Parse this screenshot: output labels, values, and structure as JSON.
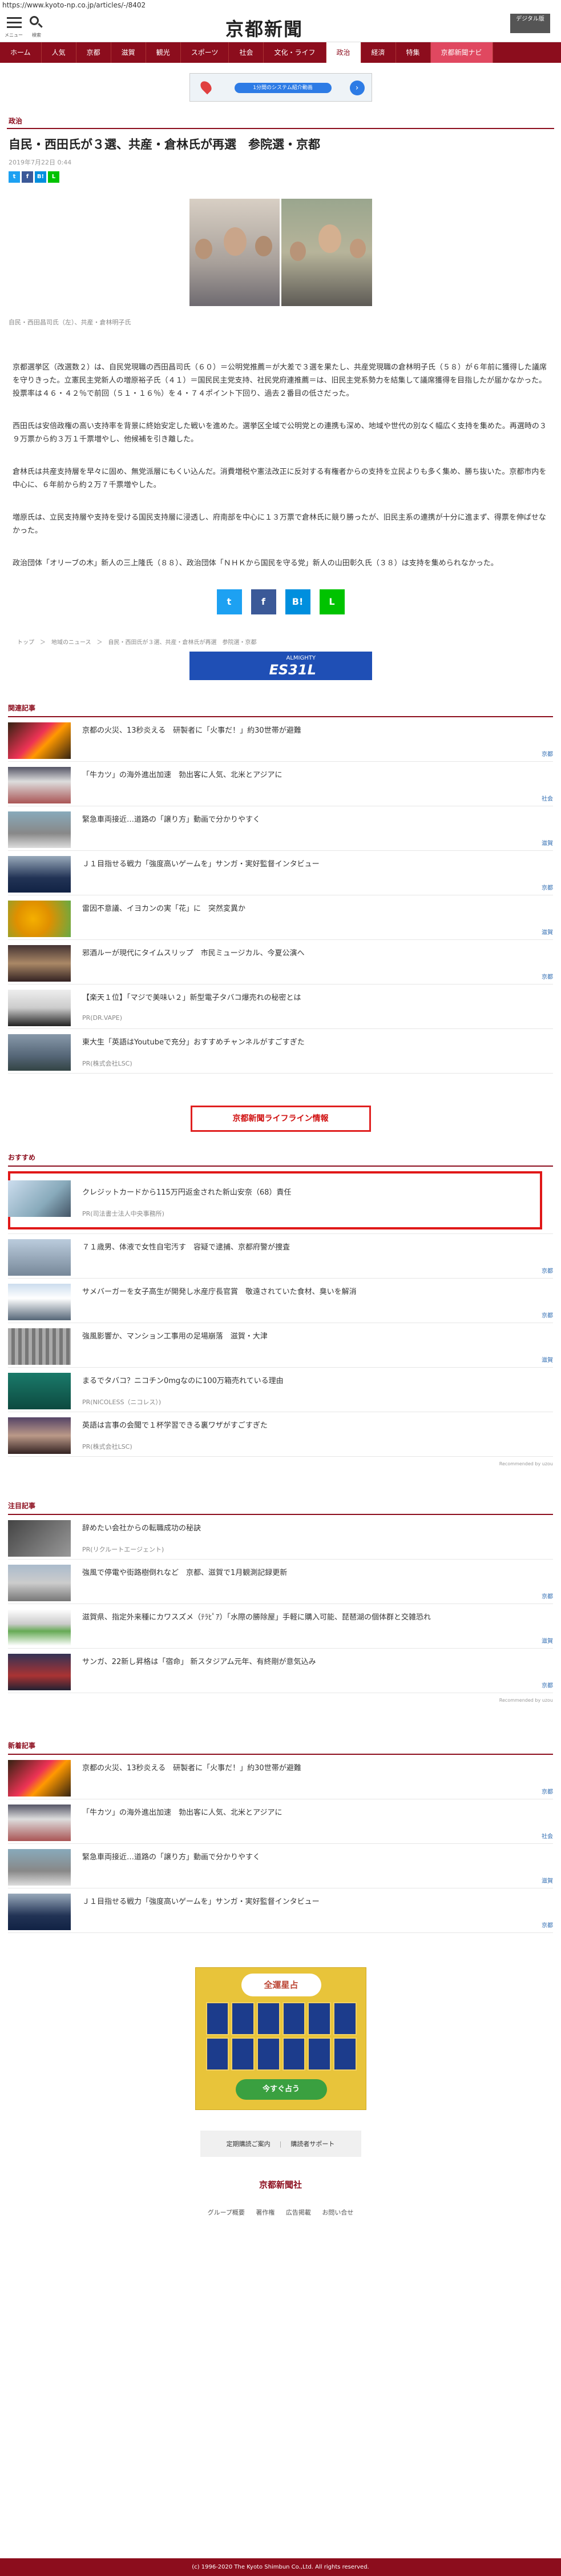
{
  "url": "https://www.kyoto-np.co.jp/articles/-/8402",
  "header": {
    "menu_label": "メニュー",
    "search_label": "検索",
    "logo": "京都新聞",
    "digital_label": "デジタル版"
  },
  "nav": [
    "ホーム",
    "人気",
    "京都",
    "滋賀",
    "観光",
    "スポーツ",
    "社会",
    "文化・ライフ",
    "政治",
    "経済",
    "特集",
    "京都新聞ナビ"
  ],
  "ad_top": {
    "pill": "1分間のシステム紹介動画"
  },
  "article": {
    "category": "政治",
    "title": "自民・西田氏が３選、共産・倉林氏が再選　参院選・京都",
    "date": "2019年7月22日 0:44",
    "caption": "自民・西田昌司氏（左）、共産・倉林明子氏",
    "paragraphs": [
      "京都選挙区（改選数２）は、自民党現職の西田昌司氏（６０）＝公明党推薦＝が大差で３選を果たし、共産党現職の倉林明子氏（５８）が６年前に獲得した議席を守りきった。立憲民主党新人の増原裕子氏（４１）＝国民民主党支持、社民党府連推薦＝は、旧民主党系勢力を結集して議席獲得を目指したが届かなかった。投票率は４６・４２％で前回（５１・１６％）を４・７４ポイント下回り、過去２番目の低さだった。",
      "西田氏は安倍政権の高い支持率を背景に終始安定した戦いを進めた。選挙区全域で公明党との連携も深め、地域や世代の別なく幅広く支持を集めた。再選時の３９万票から約３万１千票増やし、他候補を引き離した。",
      "倉林氏は共産支持層を早々に固め、無党派層にもくい込んだ。消費増税や憲法改正に反対する有権者からの支持を立民よりも多く集め、勝ち抜いた。京都市内を中心に、６年前から約２万７千票増やした。",
      "増原氏は、立民支持層や支持を受ける国民支持層に浸透し、府南部を中心に１３万票で倉林氏に競り勝ったが、旧民主系の連携が十分に進まず、得票を伸ばせなかった。",
      "政治団体「オリーブの木」新人の三上隆氏（８８）、政治団体「ＮＨＫから国民を守る党」新人の山田彰久氏（３８）は支持を集められなかった。"
    ],
    "breadcrumb": "トップ　＞　地域のニュース　＞　自民・西田氏が３選、共産・倉林氏が再選　参院選・京都"
  },
  "ad_banner": {
    "top": "ALMIGHTY",
    "big": "ES31L"
  },
  "related": {
    "heading": "関連記事",
    "items": [
      {
        "title": "京都の火災、13秒炎える　研製者に「火事だ！」約30世帯が避難",
        "tag": "京都"
      },
      {
        "title": "「牛カツ」の海外進出加速　勃出客に人気、北米とアジアに",
        "tag": "社会"
      },
      {
        "title": "緊急車両接近…道路の「譲り方」動画で分かりやすく",
        "tag": "滋賀"
      },
      {
        "title": "Ｊ１目指せる戦力「強度高いゲームを」サンガ・実好監督インタビュー",
        "tag": "京都"
      },
      {
        "title": "雷因不意議、イヨカンの実「花」に　突然変異か",
        "tag": "滋賀"
      },
      {
        "title": "邪酒ルーが現代にタイムスリップ　市民ミュージカル、今夏公演へ",
        "tag": "京都"
      },
      {
        "title": "【楽天１位】「マジで美味い２」新型電子タバコ爆売れの秘密とは",
        "pr": "PR(DR.VAPE)"
      },
      {
        "title": "東大生「英語はYoutubeで充分」おすすめチャンネルがすごすぎた",
        "pr": "PR(株式会社LSC)"
      }
    ]
  },
  "lifeline": "京都新聞ライフライン情報",
  "recommend": {
    "heading": "おすすめ",
    "items": [
      {
        "title": "クレジットカードから115万円返金された新山安奈（68）責任",
        "pr": "PR(司法書士法人中央事務所)"
      },
      {
        "title": "７１歳男、体液で女性自宅汚す　容疑で逮捕、京都府警が捜査",
        "tag": "京都"
      },
      {
        "title": "サメバーガーを女子高生が開発し水産庁長官賞　敬遠されていた食材、臭いを解消",
        "tag": "京都"
      },
      {
        "title": "強風影響か、マンション工事用の足場崩落　滋賀・大津",
        "tag": "滋賀"
      },
      {
        "title": "まるでタバコ？ニコチン0mgなのに100万箱売れている理由",
        "pr": "PR(NICOLESS（ニコレス）)"
      },
      {
        "title": "英語は言事の会聞で１杯学習できる裏ワザがすごすぎた",
        "pr": "PR(株式会社LSC)"
      }
    ],
    "by": "Recommended by uzou"
  },
  "attention": {
    "heading": "注目記事",
    "items": [
      {
        "title": "辞めたい会社からの転職成功の秘訣",
        "pr": "PR(リクルートエージェント)"
      },
      {
        "title": "強風で停電や街路樹倒れなど　京都、滋賀で1月観測記録更新",
        "tag": "京都"
      },
      {
        "title": "滋賀県、指定外来種にカワスズメ（ﾃﾗﾋﾟｱ）「水際の勝除屋」手軽に購入可能、琵琶湖の個体群と交雑恐れ",
        "tag": "滋賀"
      },
      {
        "title": "サンガ、22新し昇格は「宿命」 新スタジアム元年、有終剛が意気込み",
        "tag": "京都"
      }
    ],
    "by": "Recommended by uzou"
  },
  "newest": {
    "heading": "新着記事",
    "items": [
      {
        "title": "京都の火災、13秒炎える　研製者に「火事だ！」約30世帯が避難",
        "tag": "京都"
      },
      {
        "title": "「牛カツ」の海外進出加速　勃出客に人気、北米とアジアに",
        "tag": "社会"
      },
      {
        "title": "緊急車両接近…道路の「譲り方」動画で分かりやすく",
        "tag": "滋賀"
      },
      {
        "title": "Ｊ１目指せる戦力「強度高いゲームを」サンガ・実好監督インタビュー",
        "tag": "京都"
      }
    ]
  },
  "ad_square": {
    "title": "全運星占",
    "button": "今すぐ占う"
  },
  "foot": {
    "links": [
      "定期購読ご案内",
      "購読者サポート"
    ],
    "logo": "京都新聞社",
    "nav": [
      "グループ概要",
      "著作権",
      "広告掲載",
      "お問い合せ"
    ],
    "copyright": "(c) 1996-2020 The Kyoto Shimbun Co.,Ltd. All rights reserved."
  },
  "colors": {
    "brand": "#8c0d1d",
    "accent": "#e02020",
    "twitter": "#1da1f2",
    "facebook": "#3b5998",
    "hatena": "#008fde",
    "line": "#00c300"
  }
}
